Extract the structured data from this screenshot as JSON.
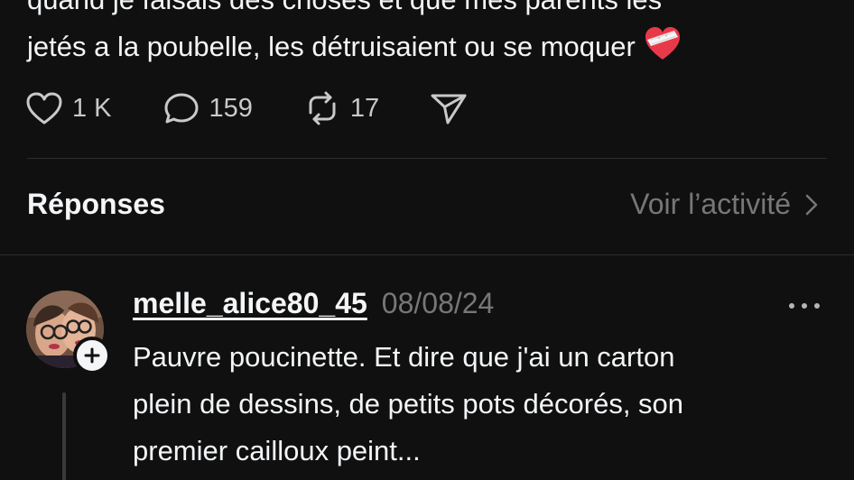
{
  "post": {
    "text_lines": [
      "quand je faisais des choses et que mes parents les",
      "jetés a la poubelle, les détruisaient ou se moquer"
    ],
    "emoji": "heart-with-bandage-emoji"
  },
  "actions": {
    "like_count": "1 K",
    "comment_count": "159",
    "repost_count": "17",
    "like_icon": "heart-outline-icon",
    "comment_icon": "speech-bubble-icon",
    "repost_icon": "repost-icon",
    "share_icon": "send-icon"
  },
  "replies_section": {
    "title": "Réponses",
    "activity_link": "Voir l’activité"
  },
  "reply": {
    "username": "melle_alice80_45",
    "date": "08/08/24",
    "text_lines": [
      "Pauvre poucinette. Et dire que j'ai un carton",
      "plein de dessins, de petits pots décorés, son",
      "premier cailloux peint..."
    ]
  },
  "colors": {
    "background": "#101010",
    "primary_text": "#f3f5f7",
    "secondary_text": "#777777",
    "divider": "#2e2e2e",
    "emoji_heart": "#e8394a"
  }
}
